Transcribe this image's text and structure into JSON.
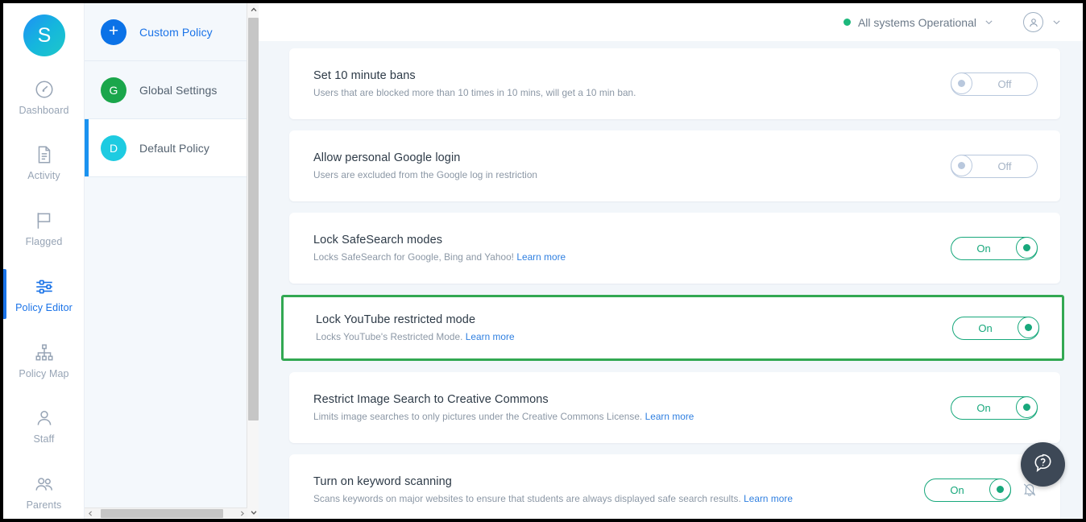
{
  "brand": {
    "logo_letter": "S",
    "accent_blue": "#1a73e8",
    "accent_green": "#18a87c",
    "highlight_green": "#32a852"
  },
  "nav": {
    "items": [
      {
        "label": "Dashboard",
        "icon": "speedometer-icon",
        "active": false
      },
      {
        "label": "Activity",
        "icon": "document-icon",
        "active": false
      },
      {
        "label": "Flagged",
        "icon": "flag-icon",
        "active": false
      },
      {
        "label": "Policy Editor",
        "icon": "sliders-icon",
        "active": true
      },
      {
        "label": "Policy Map",
        "icon": "hierarchy-icon",
        "active": false
      },
      {
        "label": "Staff",
        "icon": "person-icon",
        "active": false
      },
      {
        "label": "Parents",
        "icon": "people-icon",
        "active": false
      }
    ]
  },
  "policy_list": {
    "items": [
      {
        "label": "Custom Policy",
        "avatar": "+",
        "avatar_color": "#0b72e7",
        "selected": false,
        "is_add": true
      },
      {
        "label": "Global Settings",
        "avatar": "G",
        "avatar_color": "#1aa64b",
        "selected": false,
        "is_add": false
      },
      {
        "label": "Default Policy",
        "avatar": "D",
        "avatar_color": "#1ecbe1",
        "selected": true,
        "is_add": false
      }
    ]
  },
  "topbar": {
    "status_label": "All systems Operational",
    "status_dot_color": "#1db87c",
    "status_chevron": "chevron-down-icon",
    "account_icon": "user-avatar-icon",
    "account_chevron": "chevron-down-icon"
  },
  "settings": {
    "cards": [
      {
        "title": "Set 10 minute bans",
        "desc": "Users that are blocked more than 10 times in 10 mins, will get a 10 min ban.",
        "learn_more": "",
        "toggle_state": "Off",
        "on": false,
        "highlighted": false,
        "bell": false
      },
      {
        "title": "Allow personal Google login",
        "desc": "Users are excluded from the Google log in restriction",
        "learn_more": "",
        "toggle_state": "Off",
        "on": false,
        "highlighted": false,
        "bell": false
      },
      {
        "title": "Lock SafeSearch modes",
        "desc": "Locks SafeSearch for Google, Bing and Yahoo!",
        "learn_more": "Learn more",
        "toggle_state": "On",
        "on": true,
        "highlighted": false,
        "bell": false
      },
      {
        "title": "Lock YouTube restricted mode",
        "desc": "Locks YouTube's Restricted Mode.",
        "learn_more": "Learn more",
        "toggle_state": "On",
        "on": true,
        "highlighted": true,
        "bell": false
      },
      {
        "title": "Restrict Image Search to Creative Commons",
        "desc": "Limits image searches to only pictures under the Creative Commons License.",
        "learn_more": "Learn more",
        "toggle_state": "On",
        "on": true,
        "highlighted": false,
        "bell": false
      },
      {
        "title": "Turn on keyword scanning",
        "desc": "Scans keywords on major websites to ensure that students are always displayed safe search results.",
        "learn_more": "Learn more",
        "toggle_state": "On",
        "on": true,
        "highlighted": false,
        "bell": true,
        "bell_icon": "bell-off-icon"
      }
    ]
  },
  "help": {
    "icon": "help-question-icon"
  },
  "scrollbars": {
    "vertical_up": "chevron-up-icon",
    "vertical_down": "chevron-down-icon",
    "horizontal_left": "chevron-left-icon",
    "horizontal_right": "chevron-right-icon"
  }
}
